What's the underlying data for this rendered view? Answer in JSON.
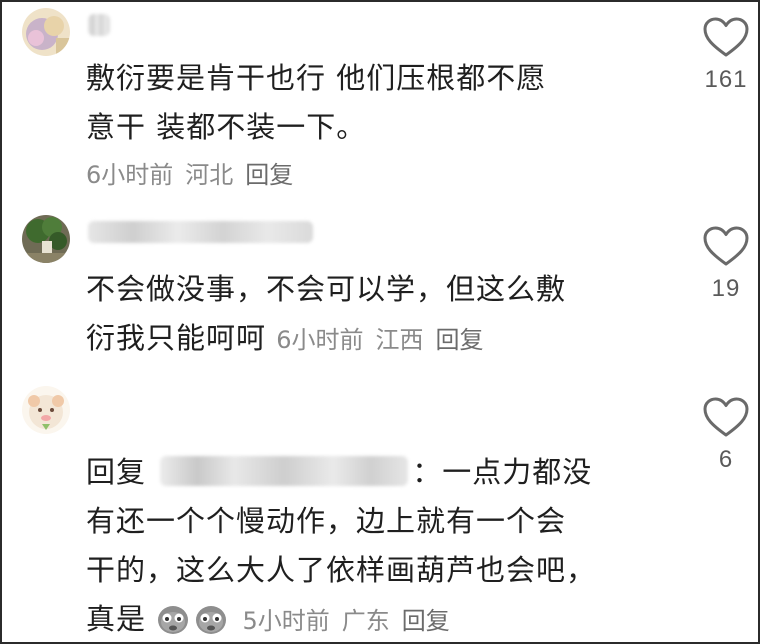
{
  "comments": [
    {
      "text_lines": [
        "敷衍要是肯干也行 他们压根都不愿",
        "意干 装都不装一下。"
      ],
      "time": "6小时前",
      "location": "河北",
      "reply_label": "回复",
      "likes": "161"
    },
    {
      "text_line_1": "不会做没事，不会可以学，但这么敷",
      "text_line_2": "衍我只能呵呵",
      "time": "6小时前",
      "location": "江西",
      "reply_label": "回复",
      "likes": "19"
    },
    {
      "reply_prefix": "回复",
      "text_after_name": "：一点力都没",
      "text_lines": [
        "有还一个个慢动作，边上就有一个会",
        "干的，这么大人了依样画葫芦也会吧，"
      ],
      "last_line_text": "真是",
      "emoji_names": [
        "wiping-tears-emoji",
        "wiping-tears-emoji"
      ],
      "time": "5小时前",
      "location": "广东",
      "reply_label": "回复",
      "likes": "6"
    }
  ],
  "colors": {
    "text": "#1f1f1f",
    "meta": "#8a8a8a",
    "icon": "#6a6a6a"
  },
  "icons": {
    "like": "heart-outline-icon"
  }
}
